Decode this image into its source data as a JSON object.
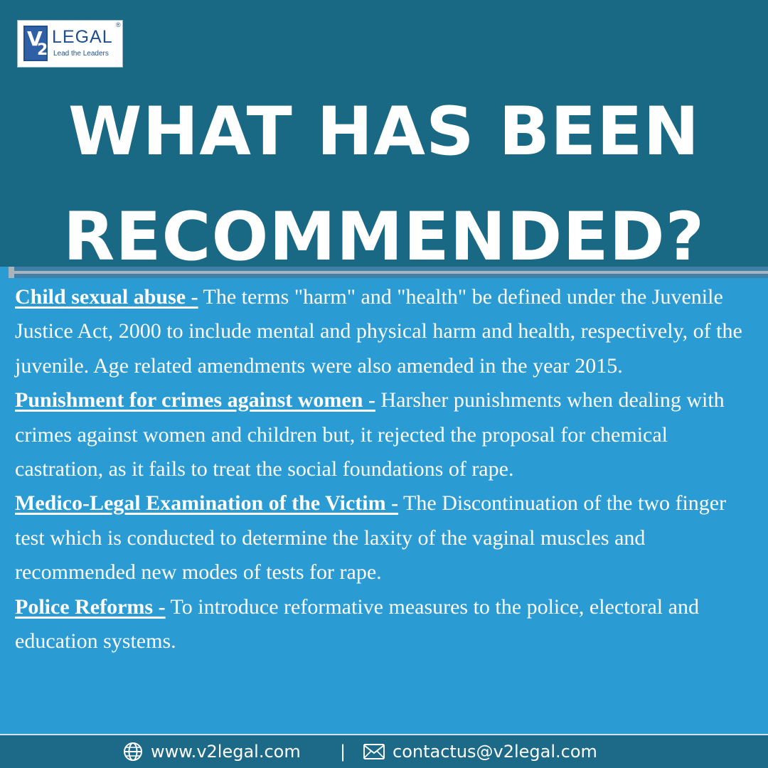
{
  "brand": {
    "logo_mark_v": "V",
    "logo_mark_2": "2",
    "name": "LEGAL",
    "registered": "®",
    "tagline": "Lead the Leaders"
  },
  "title": {
    "line1": "WHAT HAS BEEN",
    "line2": "RECOMMENDED?"
  },
  "items": [
    {
      "heading": "Child sexual abuse -",
      "text": " The terms \"harm\" and \"health\" be defined under the Juvenile Justice Act, 2000 to include mental and physical harm and health, respectively, of the juvenile. Age related amendments were also amended in the year 2015."
    },
    {
      "heading": "Punishment for crimes against women -",
      "text": " Harsher punishments when dealing with crimes against women and children but, it rejected the proposal for chemical castration, as it fails to treat the social foundations of rape."
    },
    {
      "heading": "Medico-Legal Examination of the Victim -",
      "text": " The Discontinuation of the two finger test which is conducted to determine the laxity of the vaginal muscles and recommended new modes of tests for rape."
    },
    {
      "heading": "Police Reforms -",
      "text": " To introduce reformative measures to the police, electoral and education systems."
    }
  ],
  "footer": {
    "website": "www.v2legal.com",
    "separator": "|",
    "email": "contactus@v2legal.com",
    "website_icon": "globe-icon",
    "email_icon": "envelope-icon"
  },
  "colors": {
    "header_bg": "#196884",
    "body_bg": "#2b9bd3",
    "footer_bg": "#1c6a87",
    "text": "#ffffff"
  }
}
